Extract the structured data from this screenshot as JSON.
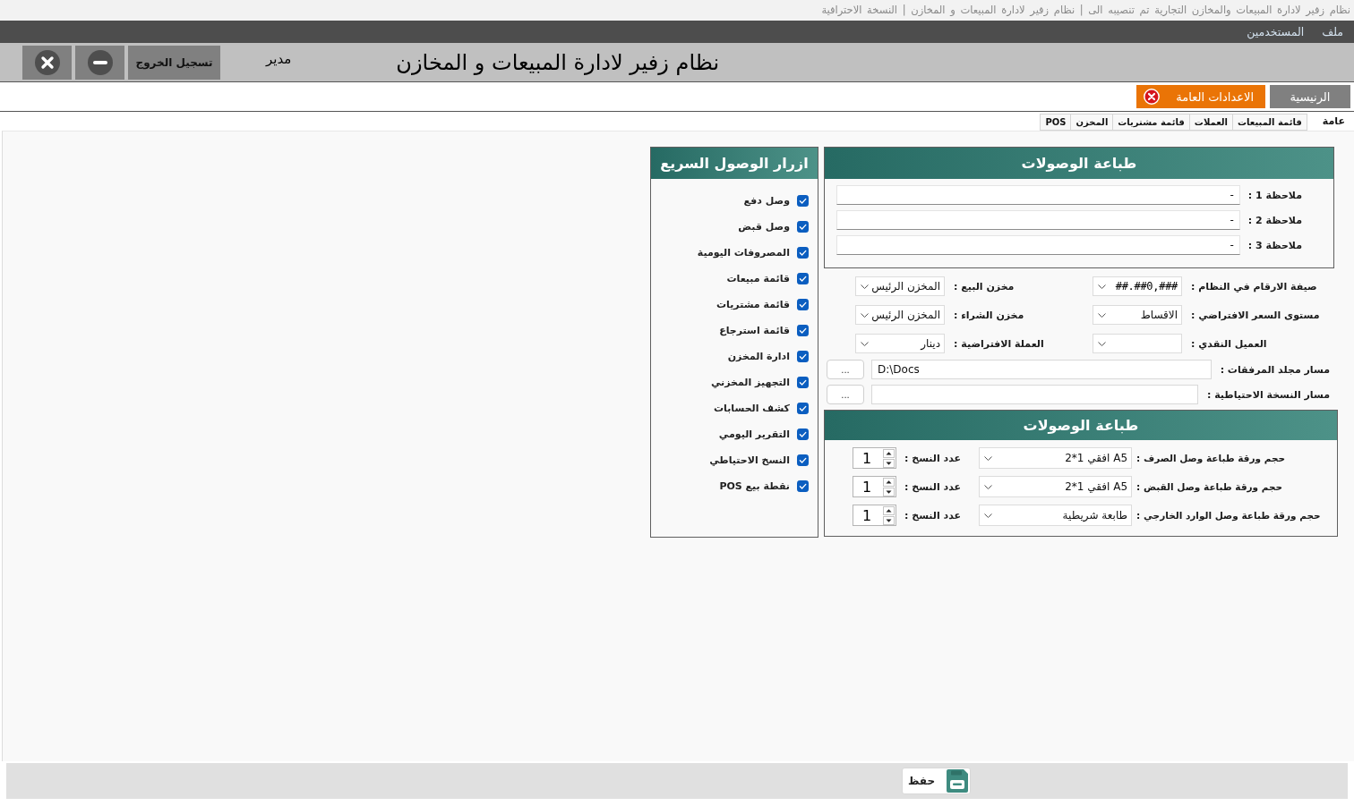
{
  "window": {
    "title": "نظام زفير لادارة المبيعات والمخازن التجارية تم تنصيبه الى | نظام زفير لادارة المبيعات و المخازن | النسخة الاحترافية"
  },
  "menu_bar": [
    "ملف",
    "المستخدمين"
  ],
  "header": {
    "title": "نظام زفير لادارة المبيعات و المخازن",
    "user_role": "مدير",
    "buttons": [
      {
        "kind": "logout",
        "label": "تسجيل الخروج"
      },
      {
        "kind": "minimize"
      },
      {
        "kind": "close"
      }
    ]
  },
  "tabs": [
    {
      "label": "الرنيسية",
      "selected": false
    },
    {
      "label": "الاعدادات العامة",
      "selected": true
    }
  ],
  "subtabs": [
    {
      "label": "عامة",
      "selected": true
    },
    {
      "label": "قائمة المبيعات",
      "selected": false
    },
    {
      "label": "العملات",
      "selected": false
    },
    {
      "label": "قائمة مشتريات",
      "selected": false
    },
    {
      "label": "المخزن",
      "selected": false
    },
    {
      "label": "POS",
      "selected": false
    }
  ],
  "receipt_notes": {
    "title": "طباعة الوصولات",
    "notes": [
      {
        "label": "ملاحظة 1 :",
        "value": "-"
      },
      {
        "label": "ملاحظة 2 :",
        "value": "-"
      },
      {
        "label": "ملاحظة 3 :",
        "value": "-"
      }
    ]
  },
  "options": [
    {
      "kind": "format",
      "label": "صيفة الارقام في النظام :",
      "value": "##.##0,###"
    },
    {
      "kind": "dropdown",
      "label": "مخزن البيع :",
      "value": "المخزن الرئيس"
    },
    {
      "kind": "dropdown",
      "label": "مستوى السعر الافتراضي :",
      "value": "الاقساط"
    },
    {
      "kind": "dropdown",
      "label": "مخزن الشراء :",
      "value": "المخزن الرئيس"
    },
    {
      "kind": "dropdown",
      "label": "العميل النقدي :"
    },
    {
      "kind": "dropdown",
      "label": "العملة الافتراضية :",
      "value": "دينار"
    }
  ],
  "paths": [
    {
      "label": "مسار مجلد المرفقات :",
      "value": "D:\\Docs",
      "button": "..."
    },
    {
      "label": "مسار النسخة الاحتياطية :",
      "button": "..."
    }
  ],
  "receipt_paper": {
    "title": "طباعة الوصولات",
    "rows": [
      {
        "label": "حجم ورقة طباعة وصل الصرف :",
        "paper": "A5 افقي 1*2",
        "copies_label": "عدد النسخ :",
        "copies": "1"
      },
      {
        "label": "حجم ورقة طباعة وصل القبض :",
        "paper": "A5 افقي 1*2",
        "copies_label": "عدد النسخ :",
        "copies": "1"
      },
      {
        "label": "حجم ورقة طباعة وصل الوارد الخارجي :",
        "paper": "طابعة شريطية",
        "copies_label": "عدد النسخ :",
        "copies": "1"
      }
    ]
  },
  "quick_access": {
    "title": "ازرار الوصول السريع",
    "items": [
      {
        "label": "وصل دفع",
        "checked": true
      },
      {
        "label": "وصل قبض",
        "checked": true
      },
      {
        "label": "المصروفات اليومية",
        "checked": true
      },
      {
        "label": "قائمة مبيعات",
        "checked": true
      },
      {
        "label": "قائمة مشتريات",
        "checked": true
      },
      {
        "label": "قائمة استرجاع",
        "checked": true
      },
      {
        "label": "ادارة المخزن",
        "checked": true
      },
      {
        "label": "التجهيز المخزني",
        "checked": true
      },
      {
        "label": "كشف الحسابات",
        "checked": true
      },
      {
        "label": "التقرير اليومي",
        "checked": true
      },
      {
        "label": "النسخ الاحتياطي",
        "checked": true
      },
      {
        "label": "نقطة بيع POS",
        "checked": true
      }
    ]
  },
  "footer": {
    "save_button": "حفظ"
  }
}
